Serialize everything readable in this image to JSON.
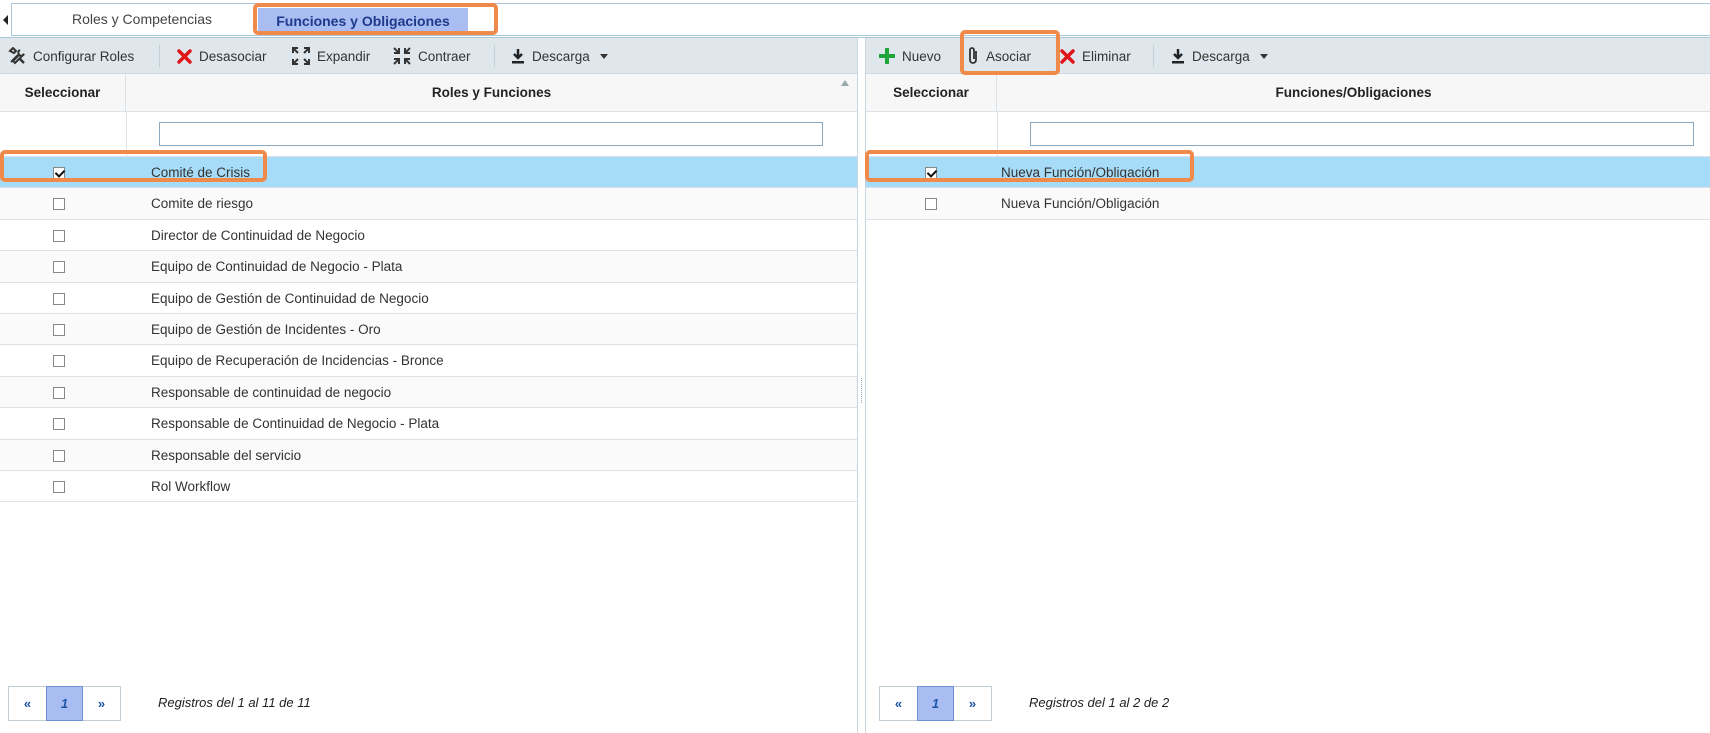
{
  "tabs": [
    {
      "label": "Roles y Competencias"
    },
    {
      "label": "Funciones y Obligaciones"
    }
  ],
  "left": {
    "toolbar": {
      "configurar": "Configurar Roles",
      "desasociar": "Desasociar",
      "expandir": "Expandir",
      "contraer": "Contraer",
      "descarga": "Descarga"
    },
    "headers": {
      "select": "Seleccionar",
      "main": "Roles y Funciones"
    },
    "filter_value": "",
    "rows": [
      {
        "label": "Comité de Crisis",
        "checked": true
      },
      {
        "label": "Comite de riesgo",
        "checked": false
      },
      {
        "label": "Director de Continuidad de Negocio",
        "checked": false
      },
      {
        "label": "Equipo de Continuidad de Negocio - Plata",
        "checked": false
      },
      {
        "label": "Equipo de Gestión de Continuidad de Negocio",
        "checked": false
      },
      {
        "label": "Equipo de Gestión de Incidentes - Oro",
        "checked": false
      },
      {
        "label": "Equipo de Recuperación de Incidencias - Bronce",
        "checked": false
      },
      {
        "label": "Responsable de continuidad de negocio",
        "checked": false
      },
      {
        "label": "Responsable de Continuidad de Negocio - Plata",
        "checked": false
      },
      {
        "label": "Responsable del servicio",
        "checked": false
      },
      {
        "label": "Rol Workflow",
        "checked": false
      }
    ],
    "pager": {
      "first": "«",
      "page": "1",
      "last": "»"
    },
    "records": "Registros del 1 al 11 de 11"
  },
  "right": {
    "toolbar": {
      "nuevo": "Nuevo",
      "asociar": "Asociar",
      "eliminar": "Eliminar",
      "descarga": "Descarga"
    },
    "headers": {
      "select": "Seleccionar",
      "main": "Funciones/Obligaciones"
    },
    "filter_value": "",
    "rows": [
      {
        "label": "Nueva Función/Obligación",
        "checked": true
      },
      {
        "label": "Nueva Función/Obligación",
        "checked": false
      }
    ],
    "pager": {
      "first": "«",
      "page": "1",
      "last": "»"
    },
    "records": "Registros del 1 al 2 de 2"
  },
  "colors": {
    "accent_highlight": "#f08a4b",
    "selected_row": "#a6dcf8",
    "active_tab": "#a9bdf3",
    "toolbar_bg": "#dfe7ec"
  }
}
